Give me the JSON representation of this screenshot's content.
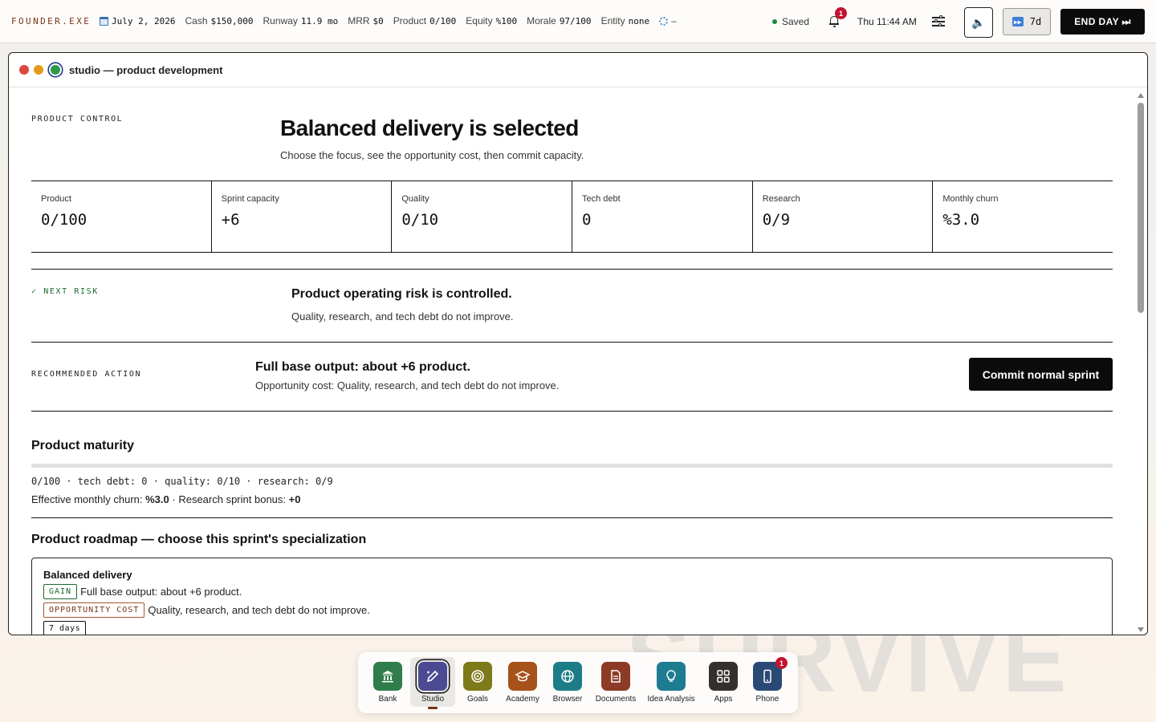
{
  "topbar": {
    "brand": "FOUNDER.EXE",
    "date": "July 2, 2026",
    "stats": [
      {
        "label": "Cash",
        "value": "$150,000"
      },
      {
        "label": "Runway",
        "value": "11.9 mo"
      },
      {
        "label": "MRR",
        "value": "$0"
      },
      {
        "label": "Product",
        "value": "0/100"
      },
      {
        "label": "Equity",
        "value": "%100"
      },
      {
        "label": "Morale",
        "value": "97/100"
      },
      {
        "label": "Entity",
        "value": "none"
      }
    ],
    "sync_value": "–",
    "saved_label": "Saved",
    "notification_count": "1",
    "clock": "Thu 11:44 AM",
    "speed_label": "7d",
    "end_day_label": "END DAY ⏭"
  },
  "window": {
    "title": "studio — product development"
  },
  "hero": {
    "kicker": "PRODUCT CONTROL",
    "title": "Balanced delivery is selected",
    "subtitle": "Choose the focus, see the opportunity cost, then commit capacity."
  },
  "metrics": [
    {
      "label": "Product",
      "value": "0/100"
    },
    {
      "label": "Sprint capacity",
      "value": "+6"
    },
    {
      "label": "Quality",
      "value": "0/10"
    },
    {
      "label": "Tech debt",
      "value": "0"
    },
    {
      "label": "Research",
      "value": "0/9"
    },
    {
      "label": "Monthly churn",
      "value": "%3.0"
    }
  ],
  "risk": {
    "kicker": "✓ NEXT RISK",
    "title": "Product operating risk is controlled.",
    "subtitle": "Quality, research, and tech debt do not improve."
  },
  "recommendation": {
    "kicker": "RECOMMENDED ACTION",
    "title": "Full base output: about +6 product.",
    "subtitle": "Opportunity cost: Quality, research, and tech debt do not improve.",
    "button": "Commit normal sprint"
  },
  "maturity": {
    "title": "Product maturity",
    "progress": 0,
    "summary": "0/100 · tech debt: 0 · quality: 0/10 · research: 0/9",
    "churn_label": "Effective monthly churn:",
    "churn_value": "%3.0",
    "bonus_label": "· Research sprint bonus:",
    "bonus_value": "+0"
  },
  "roadmap": {
    "title": "Product roadmap — choose this sprint's specialization",
    "card": {
      "title": "Balanced delivery",
      "gain_tag": "GAIN",
      "gain_text": "Full base output: about +6 product.",
      "cost_tag": "OPPORTUNITY COST",
      "cost_text": "Quality, research, and tech debt do not improve.",
      "duration": "7 days"
    }
  },
  "dock": {
    "items": [
      {
        "label": "Bank",
        "icon": "bank-icon",
        "color": "#2f7d4a"
      },
      {
        "label": "Studio",
        "icon": "pen-tool-icon",
        "color": "#4b4a93"
      },
      {
        "label": "Goals",
        "icon": "target-icon",
        "color": "#7d7a19"
      },
      {
        "label": "Academy",
        "icon": "graduation-cap-icon",
        "color": "#a6521a"
      },
      {
        "label": "Browser",
        "icon": "globe-icon",
        "color": "#1d7d86"
      },
      {
        "label": "Documents",
        "icon": "document-icon",
        "color": "#8c3b27"
      },
      {
        "label": "Idea Analysis",
        "icon": "lightbulb-icon",
        "color": "#1e7c90"
      },
      {
        "label": "Apps",
        "icon": "grid-icon",
        "color": "#34302d"
      },
      {
        "label": "Phone",
        "icon": "phone-icon",
        "color": "#2a4a75"
      }
    ],
    "phone_badge": "1"
  },
  "colors": {
    "accent": "#0b0b0b",
    "brand": "#7a3416",
    "success": "#1c6a31",
    "badge": "#c4122f"
  }
}
